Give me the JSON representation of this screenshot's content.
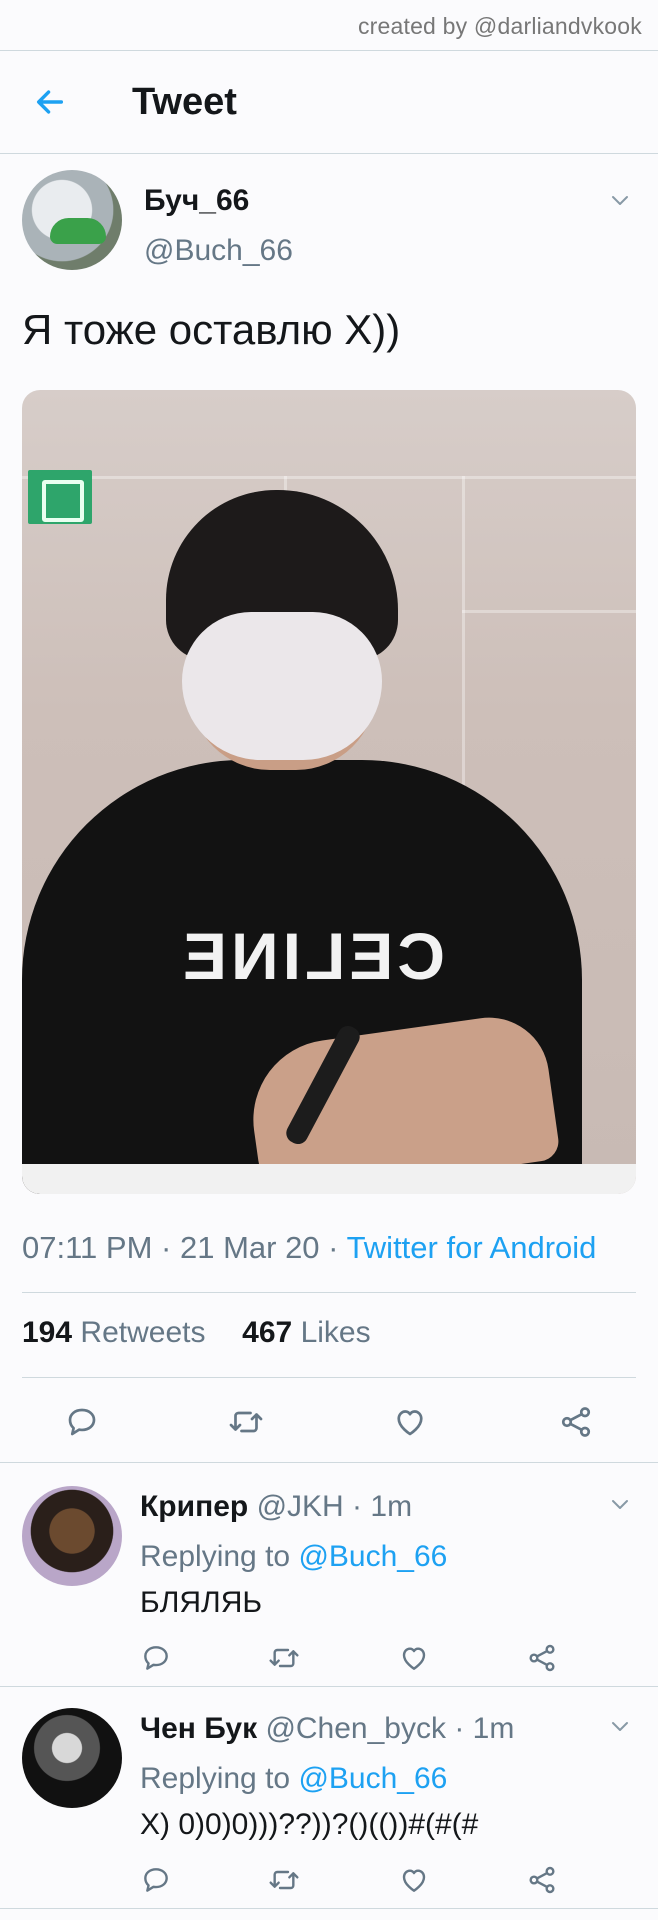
{
  "watermark": "created by @darliandvkook",
  "header": {
    "title": "Tweet",
    "back_icon": "arrow-left-icon",
    "accent_color": "#1da1f2"
  },
  "tweet": {
    "author_name": "Буч_66",
    "author_handle": "@Buch_66",
    "text": "Я тоже оставлю Х))",
    "time": "07:11 PM",
    "date": "21 Mar 20",
    "source": "Twitter for Android",
    "retweets_count": "194",
    "retweets_label": "Retweets",
    "likes_count": "467",
    "likes_label": "Likes"
  },
  "replies": [
    {
      "name": "Крипер",
      "handle": "@JKH",
      "time": "1m",
      "replying_label": "Replying to",
      "replying_to": "@Buch_66",
      "text": "БЛЯЛЯЬ"
    },
    {
      "name": "Чен Бук",
      "handle": "@Chen_byck",
      "time": "1m",
      "replying_label": "Replying to",
      "replying_to": "@Buch_66",
      "text": "Х) 0)0)0)))??))?()(())#(#(#"
    }
  ],
  "separator": "·",
  "icons": [
    "reply-icon",
    "retweet-icon",
    "like-icon",
    "share-icon",
    "caret-down-icon"
  ]
}
